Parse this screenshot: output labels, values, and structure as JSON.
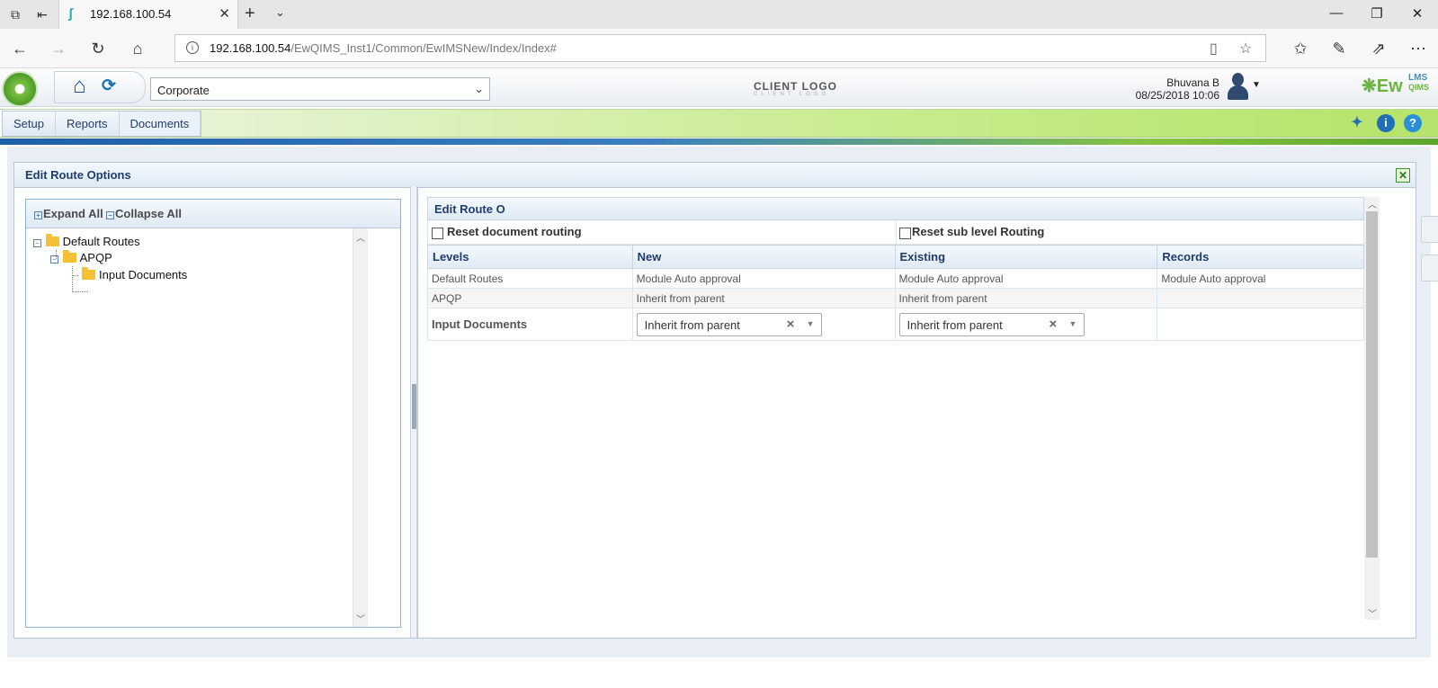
{
  "browser": {
    "tab_title": "192.168.100.54",
    "url_host": "192.168.100.54",
    "url_path": "/EwQIMS_Inst1/Common/EwIMSNew/Index/Index#"
  },
  "header": {
    "company_select": "Corporate",
    "client_logo": "CLIENT LOGO",
    "client_logo_sub": "CLIENT LOGO",
    "user_name": "Bhuvana B",
    "datetime": "08/25/2018 10:06",
    "brand": "Ew",
    "brand_lms": "LMS",
    "brand_qims": "QIMS"
  },
  "menu": {
    "items": [
      "Setup",
      "Reports",
      "Documents"
    ]
  },
  "panel": {
    "title": "Edit Route Options"
  },
  "tree": {
    "expand_all": "Expand All",
    "collapse_all": "Collapse All",
    "nodes": [
      "Default Routes",
      "APQP",
      "Input Documents"
    ]
  },
  "route": {
    "title": "Edit Route O",
    "reset_document_routing": "Reset document routing",
    "reset_sub_level_routing": "Reset sub level Routing",
    "columns": [
      "Levels",
      "New",
      "Existing",
      "Records"
    ],
    "rows": [
      {
        "level": "Default Routes",
        "new": "Module Auto approval",
        "existing": "Module Auto approval",
        "records": "Module Auto approval"
      },
      {
        "level": "APQP",
        "new": "Inherit from parent",
        "existing": "Inherit from parent",
        "records": ""
      },
      {
        "level": "Input Documents",
        "new": "Inherit from parent",
        "existing": "Inherit from parent",
        "records": ""
      }
    ]
  }
}
